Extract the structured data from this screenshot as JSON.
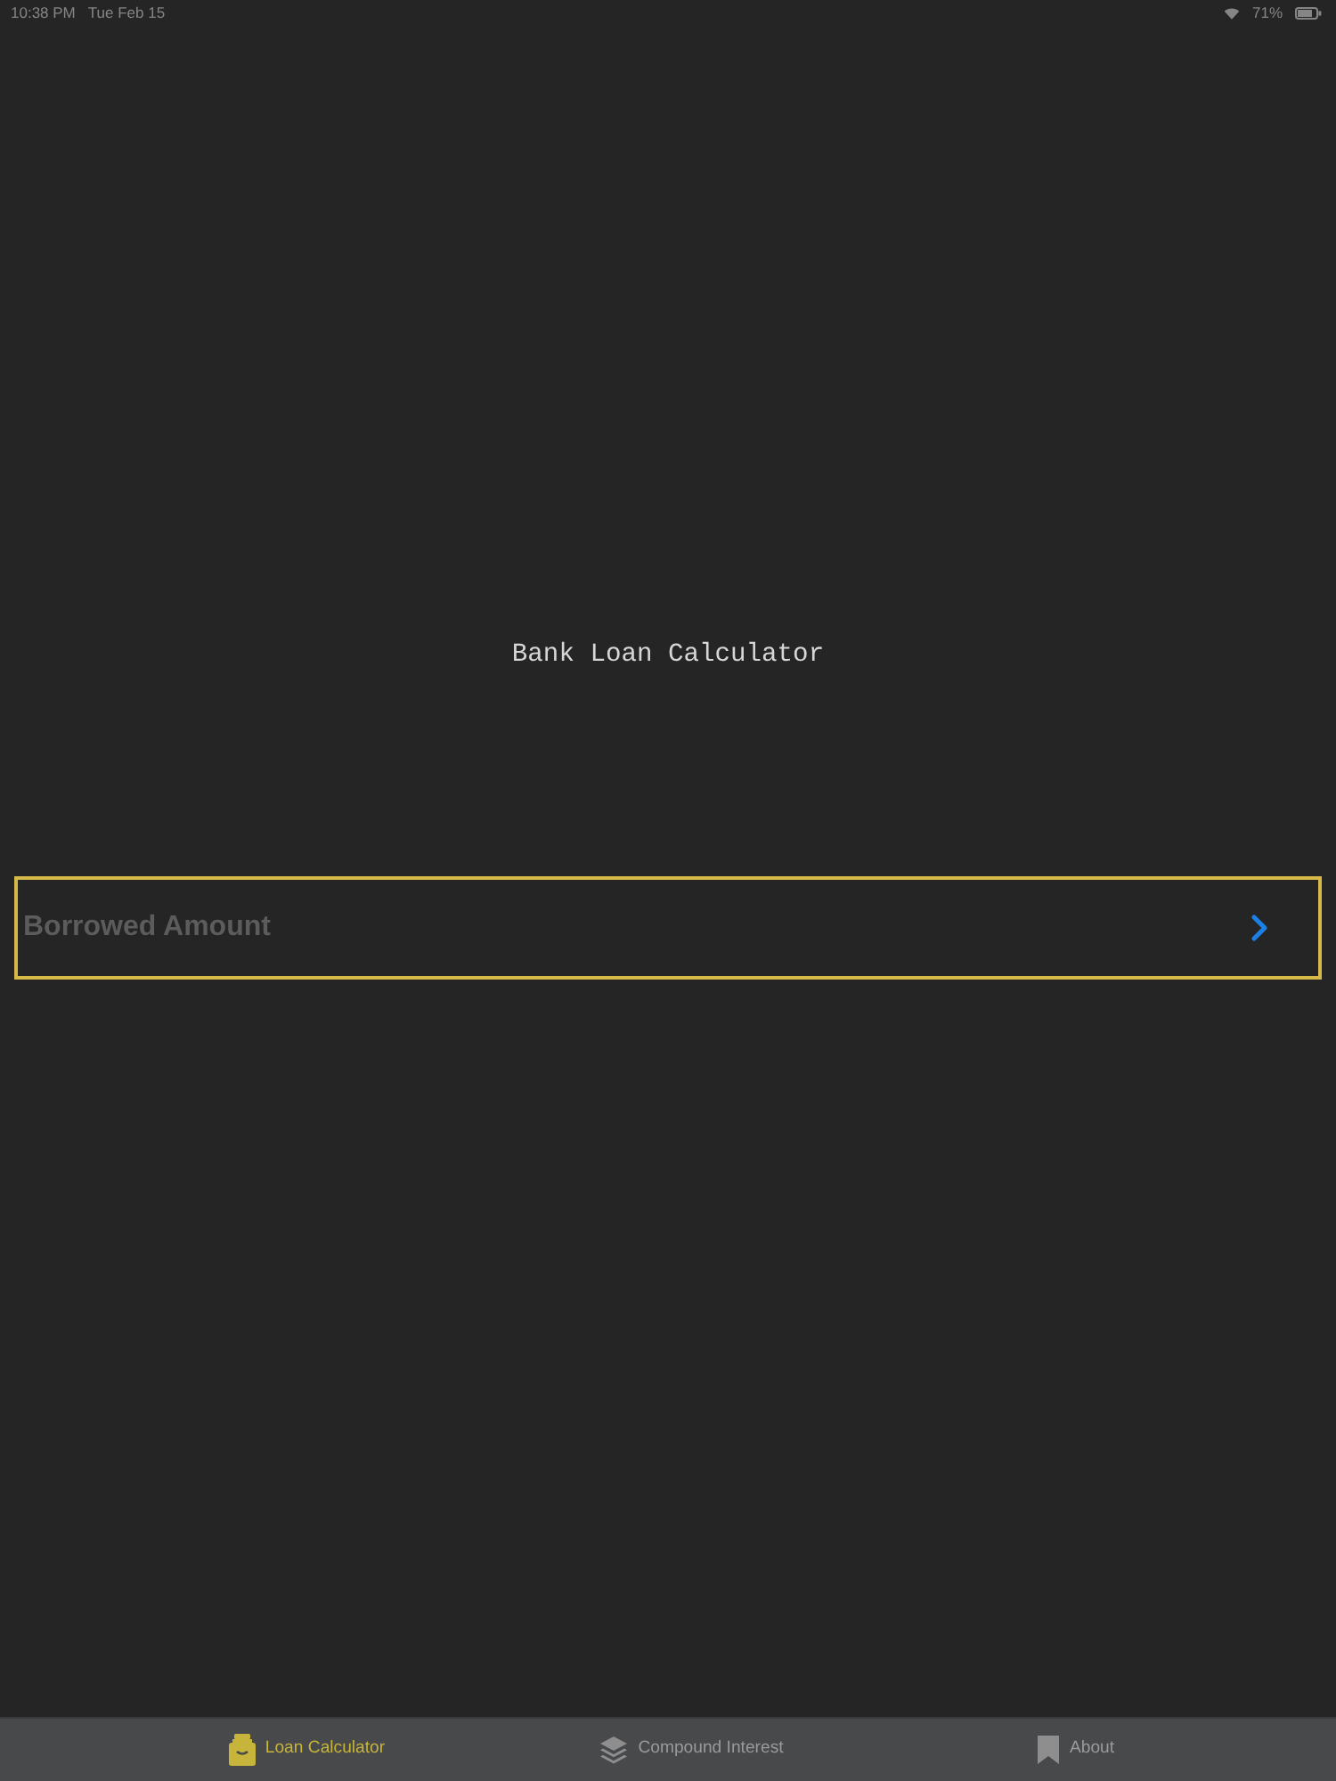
{
  "status_bar": {
    "time": "10:38 PM",
    "date": "Tue Feb 15",
    "battery": "71%"
  },
  "title": "Bank Loan Calculator",
  "amount_field": {
    "placeholder": "Borrowed Amount",
    "focused": true
  },
  "tab_bar": {
    "tabs": [
      {
        "label": "Loan Calculator",
        "selected": true
      },
      {
        "label": "Compound Interest",
        "selected": false
      },
      {
        "label": "About",
        "selected": false
      }
    ]
  }
}
